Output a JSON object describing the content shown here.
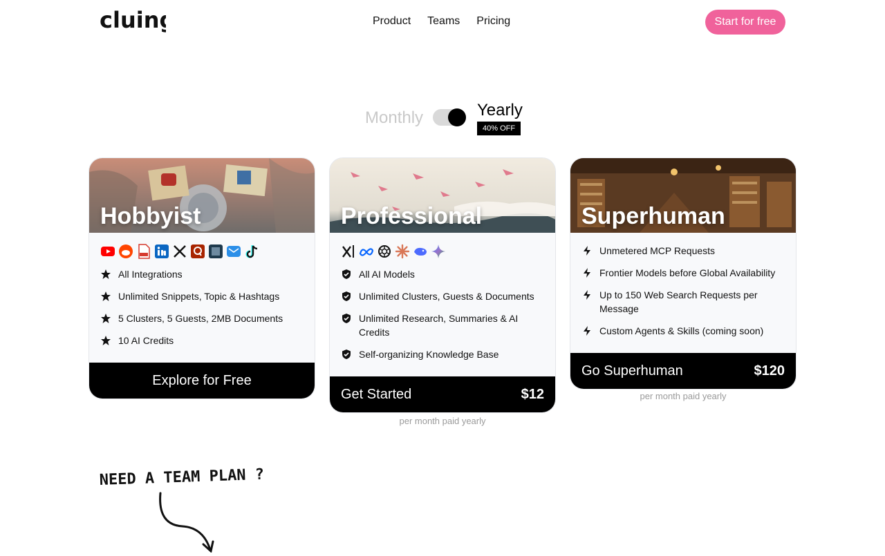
{
  "brand": {
    "logo_text": "cluing",
    "accent": "#f0629b"
  },
  "nav": {
    "links": [
      {
        "label": "Product"
      },
      {
        "label": "Teams"
      },
      {
        "label": "Pricing"
      }
    ],
    "cta_label": "Start for free"
  },
  "billing": {
    "monthly_label": "Monthly",
    "yearly_label": "Yearly",
    "discount_badge": "40% OFF",
    "selected": "Yearly"
  },
  "plans": [
    {
      "name": "Hobbyist",
      "logos": [
        "youtube-icon",
        "reddit-icon",
        "pdf-icon",
        "linkedin-icon",
        "x-icon",
        "quora-icon",
        "kindle-icon",
        "email-icon",
        "tiktok-icon"
      ],
      "feature_icon": "star-icon",
      "features": [
        "All Integrations",
        "Unlimited Snippets, Topic & Hashtags",
        "5 Clusters, 5 Guests, 2MB Documents",
        "10 AI Credits"
      ],
      "action_label": "Explore for Free",
      "price": "",
      "price_note": ""
    },
    {
      "name": "Professional",
      "logos": [
        "xai-icon",
        "meta-icon",
        "openai-icon",
        "anthropic-icon",
        "deepseek-icon",
        "gemini-icon"
      ],
      "feature_icon": "shield-check-icon",
      "features": [
        "All AI Models",
        "Unlimited Clusters, Guests & Documents",
        "Unlimited Research, Summaries & AI Credits",
        "Self-organizing Knowledge Base"
      ],
      "action_label": "Get Started",
      "price": "$12",
      "price_note": "per month paid yearly"
    },
    {
      "name": "Superhuman",
      "logos": [],
      "feature_icon": "bolt-icon",
      "features": [
        "Unmetered MCP Requests",
        "Frontier Models before Global Availability",
        "Up to 150 Web Search Requests per Message",
        "Custom Agents & Skills (coming soon)"
      ],
      "action_label": "Go Superhuman",
      "price": "$120",
      "price_note": "per month paid yearly"
    }
  ],
  "team_plan": {
    "text": "NEED A TEAM PLAN ?"
  }
}
